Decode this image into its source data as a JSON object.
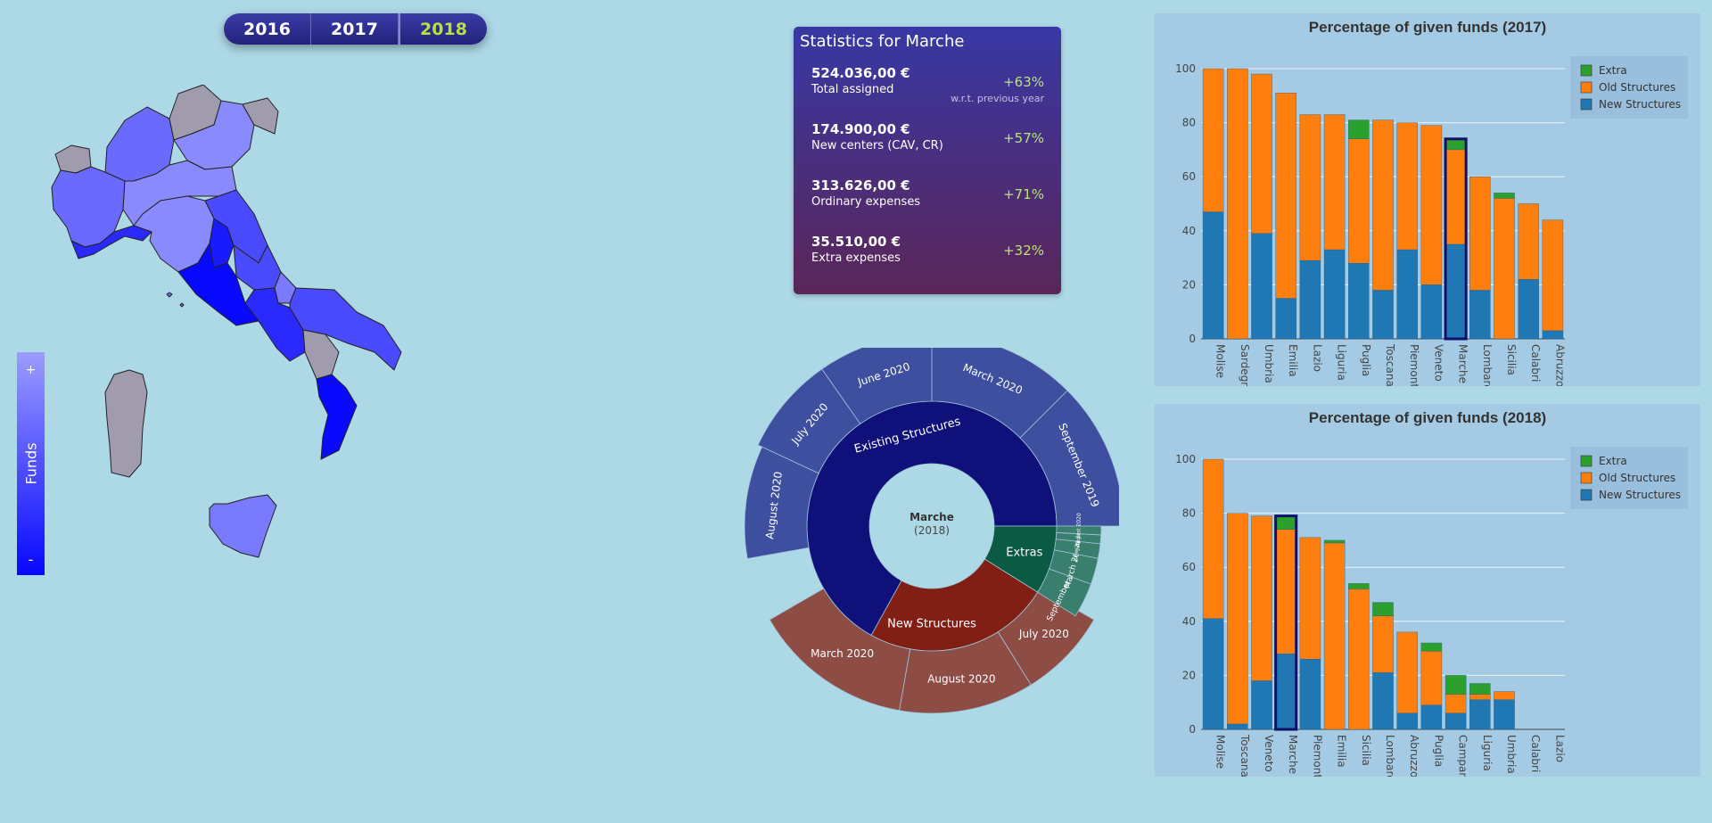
{
  "year_selector": {
    "years": [
      "2016",
      "2017",
      "2018"
    ],
    "active": "2018"
  },
  "legend": {
    "label": "Funds",
    "plus": "+",
    "minus": "-",
    "color_high": "#0000ff",
    "color_low": "#a9a9ff"
  },
  "stats": {
    "title": "Statistics for Marche",
    "items": [
      {
        "value": "524.036,00 €",
        "label": "Total assigned",
        "change": "+63%",
        "note": "w.r.t. previous year"
      },
      {
        "value": "174.900,00 €",
        "label": "New centers (CAV, CR)",
        "change": "+57%"
      },
      {
        "value": "313.626,00 €",
        "label": "Ordinary expenses",
        "change": "+71%"
      },
      {
        "value": "35.510,00 €",
        "label": "Extra expenses",
        "change": "+32%"
      }
    ]
  },
  "sunburst": {
    "center_title": "Marche",
    "center_sub": "(2018)",
    "inner": [
      "Existing Structures",
      "New Structures",
      "Extras"
    ],
    "existing": [
      "September 2019",
      "March 2020",
      "June 2020",
      "July 2020",
      "August 2020"
    ],
    "new": [
      "July 2020",
      "August 2020",
      "March 2020"
    ],
    "extras": [
      "September 2019",
      "March 2020",
      "June 2020",
      "July 2020",
      "August 2020"
    ],
    "colors": {
      "existing": "#10107a",
      "existing_outer": "#3d4f9e",
      "new": "#821f14",
      "new_outer": "#8d4d45",
      "extras": "#0b5a44",
      "extras_outer": "#3a7e6e"
    }
  },
  "chart_data": [
    {
      "type": "bar",
      "title": "Percentage of given funds (2017)",
      "categories": [
        "Molise",
        "Sardegna",
        "Umbria",
        "Emilia R",
        "Lazio",
        "Liguria",
        "Puglia",
        "Toscana",
        "Piemonte",
        "Veneto",
        "Marche",
        "Lombardia",
        "Sicilia",
        "Calabria",
        "Abruzzo"
      ],
      "ylim": [
        0,
        100
      ],
      "yticks": [
        0,
        20,
        40,
        60,
        80,
        100
      ],
      "highlight": "Marche",
      "legend_position": "top-right",
      "series": [
        {
          "name": "New Structures",
          "color": "#1f77b4",
          "values": [
            47,
            0,
            39,
            15,
            29,
            33,
            28,
            18,
            33,
            20,
            35,
            18,
            0,
            22,
            3
          ]
        },
        {
          "name": "Old Structures",
          "color": "#ff7f0e",
          "values": [
            53,
            100,
            59,
            76,
            54,
            50,
            46,
            63,
            47,
            59,
            35,
            42,
            52,
            28,
            41
          ]
        },
        {
          "name": "Extra",
          "color": "#2ca02c",
          "values": [
            0,
            0,
            0,
            0,
            0,
            0,
            7,
            0,
            0,
            0,
            4,
            0,
            2,
            0,
            0
          ]
        }
      ]
    },
    {
      "type": "bar",
      "title": "Percentage of given funds (2018)",
      "categories": [
        "Molise",
        "Toscana",
        "Veneto",
        "Marche",
        "Piemonte",
        "Emilia R",
        "Sicilia",
        "Lombardia",
        "Abruzzo",
        "Puglia",
        "Campania",
        "Liguria",
        "Umbria",
        "Calabria",
        "Lazio"
      ],
      "ylim": [
        0,
        100
      ],
      "yticks": [
        0,
        20,
        40,
        60,
        80,
        100
      ],
      "highlight": "Marche",
      "legend_position": "top-right",
      "series": [
        {
          "name": "New Structures",
          "color": "#1f77b4",
          "values": [
            41,
            2,
            18,
            28,
            26,
            0,
            0,
            21,
            6,
            9,
            6,
            11,
            11,
            0,
            0
          ]
        },
        {
          "name": "Old Structures",
          "color": "#ff7f0e",
          "values": [
            59,
            78,
            61,
            46,
            45,
            69,
            52,
            21,
            30,
            20,
            7,
            2,
            3,
            0,
            0
          ]
        },
        {
          "name": "Extra",
          "color": "#2ca02c",
          "values": [
            0,
            0,
            0,
            5,
            0,
            1,
            2,
            5,
            0,
            3,
            7,
            4,
            0,
            0,
            0
          ]
        }
      ]
    }
  ]
}
